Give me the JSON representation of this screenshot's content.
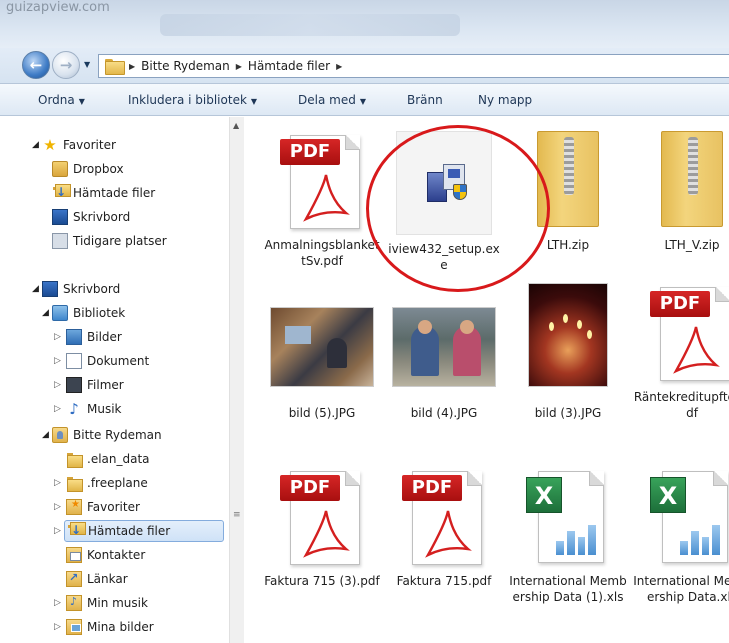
{
  "browser_ghost": "guizapview.com",
  "address": {
    "crumbs": [
      "Bitte Rydeman",
      "Hämtade filer"
    ]
  },
  "toolbar": {
    "organize": "Ordna",
    "include_library": "Inkludera i bibliotek",
    "share_with": "Dela med",
    "burn": "Bränn",
    "new_folder": "Ny mapp"
  },
  "nav": {
    "favorites": "Favoriter",
    "dropbox": "Dropbox",
    "downloads": "Hämtade filer",
    "desktop_fav": "Skrivbord",
    "recent": "Tidigare platser",
    "desktop": "Skrivbord",
    "libraries": "Bibliotek",
    "pictures": "Bilder",
    "documents": "Dokument",
    "videos": "Filmer",
    "music": "Musik",
    "user": "Bitte Rydeman",
    "elan": ".elan_data",
    "freeplane": ".freeplane",
    "user_favorites": "Favoriter",
    "user_downloads": "Hämtade filer",
    "contacts": "Kontakter",
    "links": "Länkar",
    "my_music": "Min musik",
    "my_pictures": "Mina bilder"
  },
  "files": {
    "f1": "AnmalningsblankettSv.pdf",
    "f2": "iview432_setup.exe",
    "f3": "LTH.zip",
    "f4": "LTH_V.zip",
    "f5": "bild (5).JPG",
    "f6": "bild (4).JPG",
    "f7": "bild (3).JPG",
    "f8": "Räntekreditupfter.pdf",
    "f9": "Faktura 715 (3).pdf",
    "f10": "Faktura 715.pdf",
    "f11": "International Membership Data (1).xls",
    "f12": "International Membership Data.xls"
  },
  "pdf_tag": "PDF",
  "colors": {
    "highlight_circle": "#d8191b",
    "selection": "#cfe2f7",
    "pdf_red": "#c21a1a",
    "excel_green": "#217a41"
  }
}
